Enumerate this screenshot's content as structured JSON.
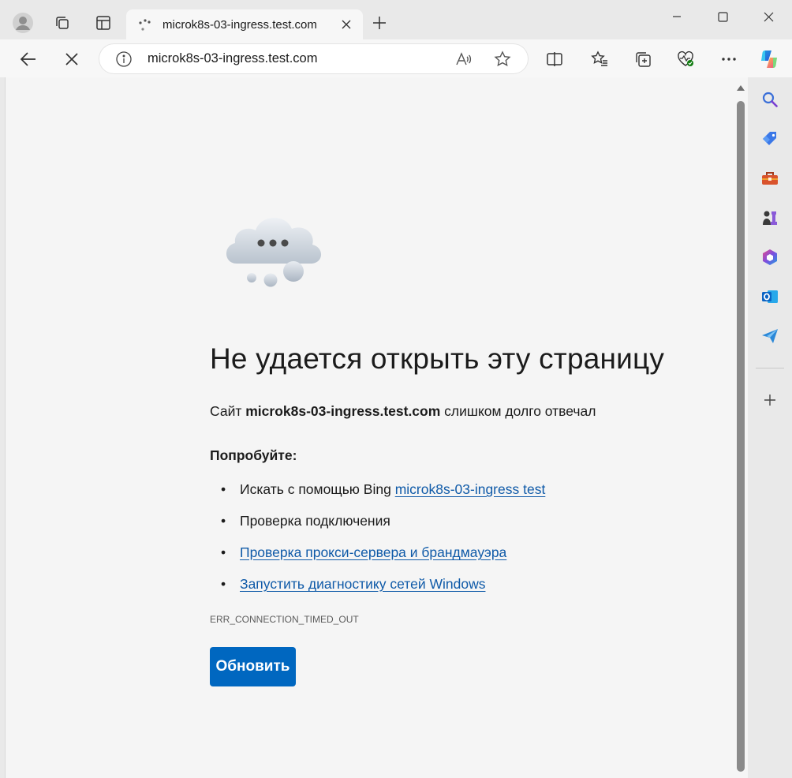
{
  "tab": {
    "title": "microk8s-03-ingress.test.com"
  },
  "address": {
    "url": "microk8s-03-ingress.test.com"
  },
  "error": {
    "title": "Не удается открыть эту страницу",
    "subtitle_prefix": "Сайт",
    "subtitle_host": "microk8s-03-ingress.test.com",
    "subtitle_suffix": "слишком долго отвечал",
    "try_label": "Попробуйте:",
    "suggestions": [
      {
        "text": "Искать с помощью Bing",
        "link": "microk8s-03-ingress test"
      },
      {
        "text": "Проверка подключения",
        "link": ""
      },
      {
        "text": "",
        "link": "Проверка прокси-сервера и брандмауэра"
      },
      {
        "text": "",
        "link": "Запустить диагностику сетей Windows"
      }
    ],
    "code": "ERR_CONNECTION_TIMED_OUT",
    "refresh_label": "Обновить"
  },
  "bullet": "•",
  "colors": {
    "accent": "#0067c0",
    "link": "#0f5aa8"
  }
}
